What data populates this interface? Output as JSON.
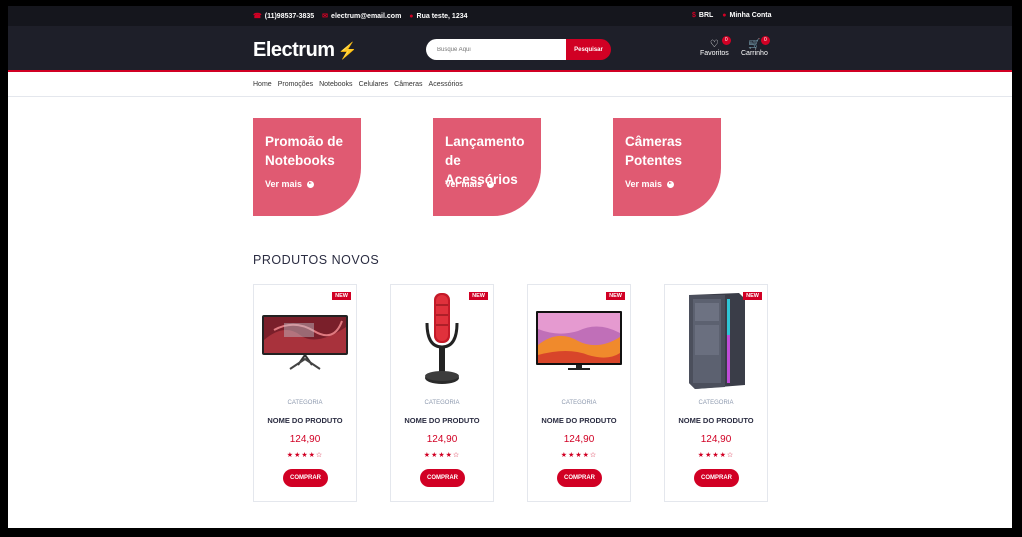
{
  "topbar": {
    "phone": "(11)98537-3835",
    "email": "electrum@email.com",
    "address": "Rua teste, 1234",
    "currency": "BRL",
    "account": "Minha Conta"
  },
  "header": {
    "logo": "Electrum",
    "search_placeholder": "Busque Aqui",
    "search_button": "Pesquisar",
    "favorites_label": "Favoritos",
    "favorites_count": "0",
    "cart_label": "Carrinho",
    "cart_count": "0"
  },
  "nav": {
    "items": [
      "Home",
      "Promoções",
      "Notebooks",
      "Celulares",
      "Câmeras",
      "Acessórios"
    ]
  },
  "promos": [
    {
      "line1": "Promoão de",
      "line2": "Notebooks",
      "more": "Ver mais"
    },
    {
      "line1": "Lançamento",
      "line2": "de Acessórios",
      "more": "Ver mais"
    },
    {
      "line1": "Câmeras",
      "line2": "Potentes",
      "more": "Ver mais"
    }
  ],
  "section_title": "PRODUTOS NOVOS",
  "products": [
    {
      "badge": "NEW",
      "category": "CATEGORIA",
      "name": "NOME DO PRODUTO",
      "price": "124,90",
      "rating": 4,
      "buy": "COMPRAR"
    },
    {
      "badge": "NEW",
      "category": "CATEGORIA",
      "name": "NOME DO PRODUTO",
      "price": "124,90",
      "rating": 4,
      "buy": "COMPRAR"
    },
    {
      "badge": "NEW",
      "category": "CATEGORIA",
      "name": "NOME DO PRODUTO",
      "price": "124,90",
      "rating": 4,
      "buy": "COMPRAR"
    },
    {
      "badge": "NEW",
      "category": "CATEGORIA",
      "name": "NOME DO PRODUTO",
      "price": "124,90",
      "rating": 4,
      "buy": "COMPRAR"
    }
  ],
  "colors": {
    "accent": "#d10024",
    "dark": "#1e1f29",
    "promo": "#e05a72"
  }
}
